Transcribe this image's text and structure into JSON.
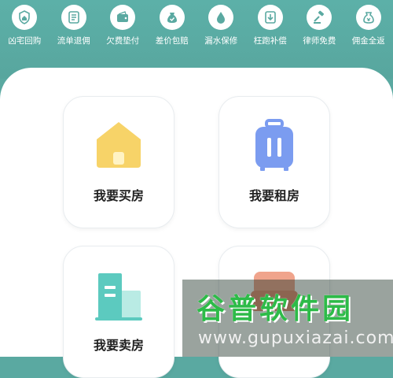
{
  "services": [
    {
      "label": "凶宅回购",
      "icon": "house-shield-icon"
    },
    {
      "label": "流单退佣",
      "icon": "refund-document-icon"
    },
    {
      "label": "欠费垫付",
      "icon": "wallet-icon"
    },
    {
      "label": "差价包赔",
      "icon": "money-bag-check-icon"
    },
    {
      "label": "漏水保修",
      "icon": "water-drop-icon"
    },
    {
      "label": "枉跑补偿",
      "icon": "arrow-down-compensation-icon"
    },
    {
      "label": "律师免费",
      "icon": "gavel-icon"
    },
    {
      "label": "佣金全返",
      "icon": "money-bag-icon"
    }
  ],
  "cards": [
    {
      "label": "我要买房",
      "icon": "house-icon"
    },
    {
      "label": "我要租房",
      "icon": "suitcase-icon"
    },
    {
      "label": "我要卖房",
      "icon": "building-icon"
    },
    {
      "label": "",
      "icon": "sofa-icon"
    }
  ],
  "watermark": {
    "title": "谷普软件园",
    "url": "www.gupuxiazai.com"
  },
  "colors": {
    "header": "#5aa9a1",
    "house": "#f7d368",
    "suitcase": "#7b9cf0",
    "building": "#5ccabf",
    "sofa": "#f0a48c"
  }
}
